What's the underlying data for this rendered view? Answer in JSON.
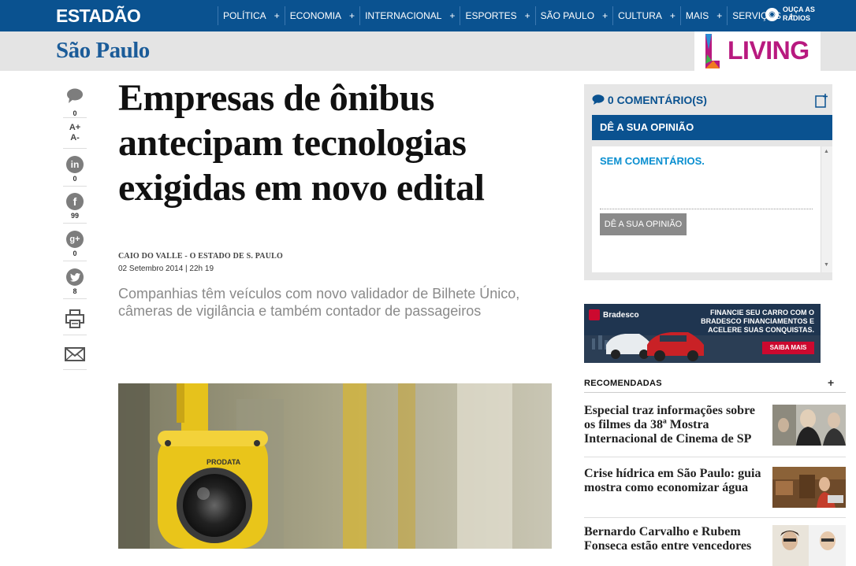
{
  "header": {
    "logo": "ESTADÃO",
    "nav": [
      {
        "label": "POLÍTICA"
      },
      {
        "label": "ECONOMIA"
      },
      {
        "label": "INTERNACIONAL"
      },
      {
        "label": "ESPORTES"
      },
      {
        "label": "SÃO PAULO"
      },
      {
        "label": "CULTURA"
      },
      {
        "label": "MAIS"
      },
      {
        "label": "SERVIÇOS"
      }
    ],
    "nav_plus": "+",
    "radio_line1": "OUÇA AS",
    "radio_line2": "RÁDIOS"
  },
  "section": {
    "title": "São Paulo",
    "sponsor": "LIVING"
  },
  "share": {
    "comments": "0",
    "font_up": "A+",
    "font_down": "A-",
    "linkedin": "0",
    "facebook": "99",
    "googleplus": "0",
    "twitter": "8"
  },
  "article": {
    "headline": "Empresas de ônibus antecipam tecnologias exigidas em novo edital",
    "byline": "CAIO DO VALLE - O ESTADO DE S. PAULO",
    "date": "02 Setembro 2014 | 22h 19",
    "subtitle": "Companhias têm veículos com novo validador de Bilhete Único, câmeras de vigilância e também contador de passageiros",
    "photo_brand": "PRODATA"
  },
  "comments": {
    "header": "0 COMENTÁRIO(S)",
    "opine": "DÊ A SUA OPINIÃO",
    "none": "SEM COMENTÁRIOS.",
    "opine_button": "DÊ A SUA OPINIÃO"
  },
  "ad": {
    "brand": "Bradesco",
    "text": "FINANCIE SEU CARRO COM O BRADESCO FINANCIAMENTOS E ACELERE SUAS CONQUISTAS.",
    "cta": "SAIBA MAIS"
  },
  "recommended": {
    "header": "RECOMENDADAS",
    "plus": "+",
    "items": [
      {
        "title": "Especial traz informações sobre os filmes da 38ª Mostra Internacional de Cinema de SP"
      },
      {
        "title": "Crise hídrica em São Paulo: guia mostra como economizar água"
      },
      {
        "title": "Bernardo Carvalho e Rubem Fonseca estão entre vencedores"
      }
    ]
  },
  "colors": {
    "brand_blue": "#0a5290",
    "section_title": "#1b5c99",
    "living_magenta": "#b8197f",
    "comment_accent": "#0a8fd0"
  }
}
